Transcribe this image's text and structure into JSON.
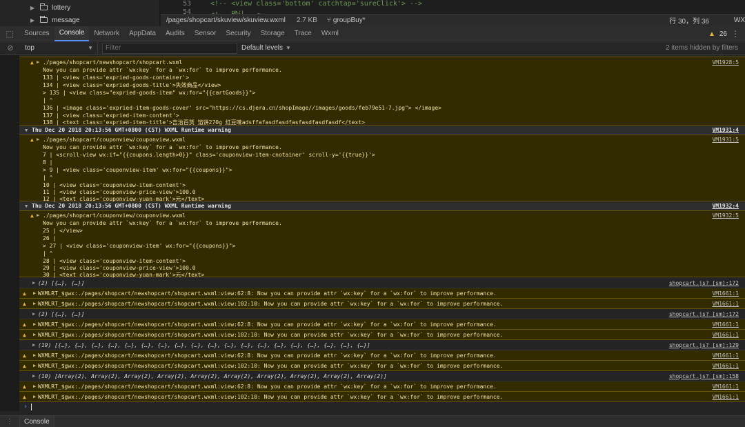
{
  "file_tree": {
    "items": [
      {
        "name": "lottery"
      },
      {
        "name": "message"
      }
    ]
  },
  "editor": {
    "lines": [
      {
        "num": "53",
        "code": "<!-- <view class='bottom' catchtap='sureClick'> -->"
      },
      {
        "num": "54",
        "code": "<!-- 确认 -->"
      }
    ]
  },
  "status_bar": {
    "path": "/pages/shopcart/skuview/skuview.wxml",
    "size": "2.7 KB",
    "branch": "groupBuy*",
    "position": "行 30，列 36",
    "lang": "WX"
  },
  "devtools": {
    "tabs": [
      "Sources",
      "Console",
      "Network",
      "AppData",
      "Audits",
      "Sensor",
      "Security",
      "Storage",
      "Trace",
      "Wxml"
    ],
    "active_tab": "Console",
    "warning_count": "26"
  },
  "console_toolbar": {
    "context": "top",
    "filter_placeholder": "Filter",
    "levels": "Default levels",
    "hidden_note": "2 items hidden by filters"
  },
  "log": {
    "block1": {
      "lines": [
        {
          "text": "./pages/shopcart/newshopcart/shopcart.wxml",
          "src": "VM1928:5"
        },
        {
          "text": "Now you can provide attr `wx:key` for a `wx:for` to improve performance."
        },
        {
          "text": "  133 |       <view class='expried-goods-container'>"
        },
        {
          "text": "  134 |         <view class='expried-goods-title'>失效商品</view>"
        },
        {
          "text": "> 135 |         <view class=\"expried-goods-item\" wx:for=\"{{cartGoods}}\">"
        },
        {
          "text": "      |           ^"
        },
        {
          "text": "  136 |           <image class='expried-item-goods-cover' src=\"https://cs.djera.cn/shopImage//images/goods/feb79e51-7.jpg\"> </image>"
        },
        {
          "text": "  137 |           <view class='expried-item-content'>"
        },
        {
          "text": "  138 |             <text class='expried-item-title'>吉治百货 馅饼270g 红豆味adsffafasdfasdfasfasdfasdfasdf</text>"
        }
      ]
    },
    "group2": {
      "header": "Thu Dec 20 2018 20:13:56 GMT+0800 (CST) WXML Runtime warning",
      "src": "VM1931:4"
    },
    "block2": {
      "lines": [
        {
          "text": "./pages/shopcart/couponview/couponview.wxml",
          "src": "VM1931:5"
        },
        {
          "text": "Now you can provide attr `wx:key` for a `wx:for` to improve performance."
        },
        {
          "text": "    7 |     <scroll-view  wx:if=\"{{coupons.length>0}}\" class='couponview-item-cnotainer' scroll-y='{{true}}'>"
        },
        {
          "text": "    8 |"
        },
        {
          "text": ">   9 |       <view class='couponview-item' wx:for=\"{{coupons}}\">"
        },
        {
          "text": "      |        ^"
        },
        {
          "text": "   10 |         <view class='couponview-item-content'>"
        },
        {
          "text": "   11 |           <view class='couponview-price-view'>100.0"
        },
        {
          "text": "   12 |             <text class='couponview-yuan-mark'>元</text>"
        }
      ]
    },
    "group3": {
      "header": "Thu Dec 20 2018 20:13:56 GMT+0800 (CST) WXML Runtime warning",
      "src": "VM1932:4"
    },
    "block3": {
      "lines": [
        {
          "text": "./pages/shopcart/couponview/couponview.wxml",
          "src": "VM1932:5"
        },
        {
          "text": "Now you can provide attr `wx:key` for a `wx:for` to improve performance."
        },
        {
          "text": "   25 |       </view>"
        },
        {
          "text": "   26 |"
        },
        {
          "text": ">  27 |       <view class='couponview-item' wx:for=\"{{coupons}}\">"
        },
        {
          "text": "      |        ^"
        },
        {
          "text": "   28 |         <view class='couponview-item-content'>"
        },
        {
          "text": "   29 |           <view class='couponview-price-view'>100.0"
        },
        {
          "text": "   30 |             <text class='couponview-yuan-mark'>元</text>"
        }
      ]
    },
    "rows": [
      {
        "kind": "log",
        "text": "(2) [{…}, {…}]",
        "src": "shopcart.js? [sm]:172"
      },
      {
        "kind": "warn",
        "text": "WXMLRT_$gwx:./pages/shopcart/newshopcart/shopcart.wxml:view:62:8: Now you can provide attr `wx:key` for a `wx:for` to improve performance.",
        "src": "VM1661:1"
      },
      {
        "kind": "warn",
        "text": "WXMLRT_$gwx:./pages/shopcart/newshopcart/shopcart.wxml:view:102:10: Now you can provide attr `wx:key` for a `wx:for` to improve performance.",
        "src": "VM1661:1"
      },
      {
        "kind": "log",
        "text": "(2) [{…}, {…}]",
        "src": "shopcart.js? [sm]:172"
      },
      {
        "kind": "warn",
        "text": "WXMLRT_$gwx:./pages/shopcart/newshopcart/shopcart.wxml:view:62:8: Now you can provide attr `wx:key` for a `wx:for` to improve performance.",
        "src": "VM1661:1"
      },
      {
        "kind": "warn",
        "text": "WXMLRT_$gwx:./pages/shopcart/newshopcart/shopcart.wxml:view:102:10: Now you can provide attr `wx:key` for a `wx:for` to improve performance.",
        "src": "VM1661:1"
      },
      {
        "kind": "log",
        "text": "(19) [{…}, {…}, {…}, {…}, {…}, {…}, {…}, {…}, {…}, {…}, {…}, {…}, {…}, {…}, {…}, {…}, {…}, {…}, {…}]",
        "src": "shopcart.js? [sm]:129"
      },
      {
        "kind": "warn",
        "text": "WXMLRT_$gwx:./pages/shopcart/newshopcart/shopcart.wxml:view:62:8: Now you can provide attr `wx:key` for a `wx:for` to improve performance.",
        "src": "VM1661:1"
      },
      {
        "kind": "warn",
        "text": "WXMLRT_$gwx:./pages/shopcart/newshopcart/shopcart.wxml:view:102:10: Now you can provide attr `wx:key` for a `wx:for` to improve performance.",
        "src": "VM1661:1"
      },
      {
        "kind": "log",
        "text": "(10) [Array(2), Array(2), Array(2), Array(2), Array(2), Array(2), Array(2), Array(2), Array(2), Array(2)]",
        "src": "shopcart.js? [sm]:158"
      },
      {
        "kind": "warn",
        "text": "WXMLRT_$gwx:./pages/shopcart/newshopcart/shopcart.wxml:view:62:8: Now you can provide attr `wx:key` for a `wx:for` to improve performance.",
        "src": "VM1661:1"
      },
      {
        "kind": "warn",
        "text": "WXMLRT_$gwx:./pages/shopcart/newshopcart/shopcart.wxml:view:102:10: Now you can provide attr `wx:key` for a `wx:for` to improve performance.",
        "src": "VM1661:1"
      }
    ]
  },
  "drawer": {
    "tab": "Console"
  }
}
